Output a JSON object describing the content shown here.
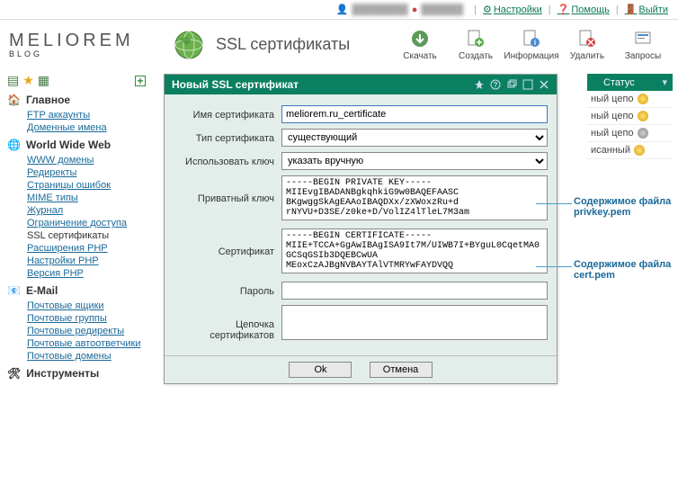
{
  "topbar": {
    "settings": "Настройки",
    "help": "Помощь",
    "logout": "Выйти"
  },
  "logo": {
    "main": "MELIOREM",
    "sub": "BLOG"
  },
  "page_title": "SSL сертификаты",
  "toolbar": {
    "download": "Скачать",
    "create": "Создать",
    "info": "Информация",
    "delete": "Удалить",
    "requests": "Запросы"
  },
  "sidebar": {
    "main": {
      "title": "Главное",
      "items": [
        "FTP аккаунты",
        "Доменные имена"
      ]
    },
    "www": {
      "title": "World Wide Web",
      "items": [
        "WWW домены",
        "Редиректы",
        "Страницы ошибок",
        "MIME типы",
        "Журнал",
        "Ограничение доступа",
        "SSL сертификаты",
        "Расширения PHP",
        "Настройки PHP",
        "Версия PHP"
      ]
    },
    "email": {
      "title": "E-Mail",
      "items": [
        "Почтовые ящики",
        "Почтовые группы",
        "Почтовые редиректы",
        "Почтовые автоответчики",
        "Почтовые домены"
      ]
    },
    "tools": {
      "title": "Инструменты"
    }
  },
  "right": {
    "header": "Статус",
    "rows": [
      "ный цепо",
      "ный цепо",
      "ный цепо",
      "исанный"
    ]
  },
  "modal": {
    "title": "Новый SSL сертификат",
    "labels": {
      "name": "Имя сертификата",
      "type": "Тип сертификата",
      "usekey": "Использовать ключ",
      "privkey": "Приватный ключ",
      "cert": "Сертификат",
      "password": "Пароль",
      "chain": "Цепочка сертификатов"
    },
    "values": {
      "name": "meliorem.ru_certificate",
      "type": "существующий",
      "usekey": "указать вручную",
      "privkey": "-----BEGIN PRIVATE KEY-----\nMIIEvgIBADANBgkqhkiG9w0BAQEFAASC\nBKgwggSkAgEAAoIBAQDXx/zXWoxzRu+d\nrNYVU+D3SE/z0ke+D/VolIZ4lTleL7M3am",
      "cert": "-----BEGIN CERTIFICATE-----\nMIIE+TCCA+GgAwIBAgISA9It7M/UIWB7I+BYguL0CqetMA0GCSqGSIb3DQEBCwUA\nMEoxCzAJBgNVBAYTAlVTMRYwFAYDVQQ",
      "password": "",
      "chain": ""
    },
    "buttons": {
      "ok": "Ok",
      "cancel": "Отмена"
    }
  },
  "annotations": {
    "privkey": "Содержимое файла privkey.pem",
    "cert": "Содержимое файла cert.pem"
  }
}
